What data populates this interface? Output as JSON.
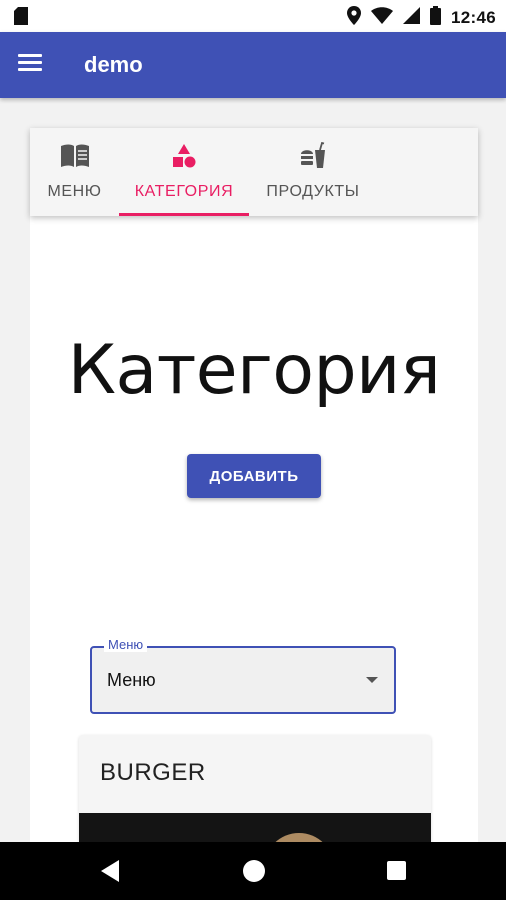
{
  "status_bar": {
    "time": "12:46",
    "icons": [
      "sd-card-icon",
      "location-icon",
      "wifi-icon",
      "signal-icon",
      "battery-icon"
    ]
  },
  "app_bar": {
    "title": "demo",
    "color": "#3f51b5",
    "menu_icon": "hamburger-menu-icon"
  },
  "tabs": [
    {
      "label": "МЕНЮ",
      "icon": "book-icon",
      "active": false
    },
    {
      "label": "КАТЕГОРИЯ",
      "icon": "shapes-icon",
      "active": true
    },
    {
      "label": "ПРОДУКТЫ",
      "icon": "fastfood-icon",
      "active": false
    }
  ],
  "accent_color": "#e91e63",
  "main": {
    "heading": "Категория",
    "add_button_label": "ДОБАВИТЬ"
  },
  "menu_select": {
    "label": "Меню",
    "value": "Меню"
  },
  "items": [
    {
      "title": "BURGER"
    }
  ],
  "nav_bar": {
    "buttons": [
      "back-icon",
      "home-icon",
      "recent-apps-icon"
    ]
  }
}
